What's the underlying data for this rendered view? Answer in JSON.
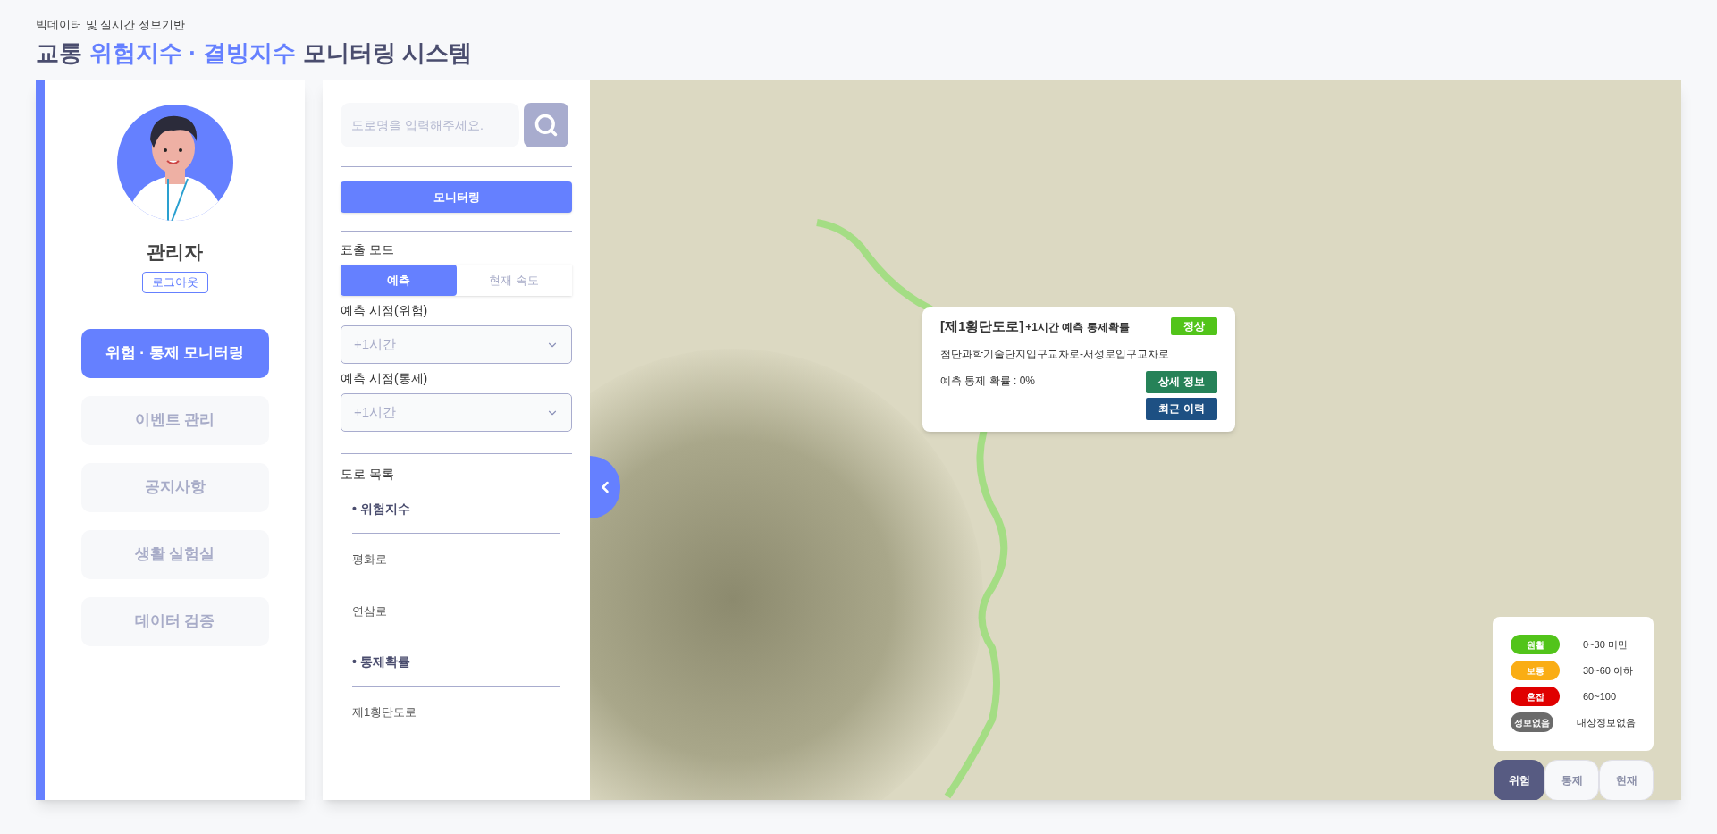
{
  "header": {
    "subtitle": "빅데이터 및 실시간 정보기반",
    "title_parts": [
      {
        "text": "교통",
        "highlight": false
      },
      {
        "text": "위험지수 · 결빙지수",
        "highlight": true
      },
      {
        "text": "모니터링 시스템",
        "highlight": false
      }
    ]
  },
  "profile": {
    "name": "관리자",
    "logout": "로그아웃"
  },
  "nav": [
    {
      "label": "위험 · 통제 모니터링",
      "selected": true
    },
    {
      "label": "이벤트 관리",
      "selected": false
    },
    {
      "label": "공지사항",
      "selected": false
    },
    {
      "label": "생활 실험실",
      "selected": false
    },
    {
      "label": "데이터 검증",
      "selected": false
    }
  ],
  "panel": {
    "search": {
      "placeholder": "도로명을 입력해주세요."
    },
    "monitor_button": "모니터링",
    "mode_label": "표출 모드",
    "modes": [
      {
        "label": "예측",
        "selected": true
      },
      {
        "label": "현재 속도",
        "selected": false
      }
    ],
    "selects": [
      {
        "label": "예측 시점(위험)",
        "value": "+1시간"
      },
      {
        "label": "예측 시점(통제)",
        "value": "+1시간"
      }
    ],
    "road_list_label": "도로 목록",
    "groups": [
      {
        "title": "• 위험지수",
        "roads": [
          "평화로",
          "연삼로"
        ]
      },
      {
        "title": "• 통제확률",
        "roads": [
          "제1횡단도로"
        ]
      }
    ]
  },
  "popup": {
    "road": "[제1횡단도로]",
    "subtitle": "+1시간 예측 통제확률",
    "status": {
      "label": "정상",
      "kind": "normal"
    },
    "segment": "첨단과학기술단지입구교차로-서성로입구교차로",
    "probability": "예측 통제 확률 : 0%",
    "buttons": [
      "상세 정보",
      "최근 이력"
    ]
  },
  "legend": [
    {
      "label": "원활",
      "range": "0~30 미만",
      "color": "#52c41a"
    },
    {
      "label": "보통",
      "range": "30~60 이하",
      "color": "#faad14"
    },
    {
      "label": "혼잡",
      "range": "60~100",
      "color": "#e00000"
    },
    {
      "label": "정보없음",
      "range": "대상정보없음",
      "color": "#6b6b6b"
    }
  ],
  "map_modes": [
    {
      "label": "위험",
      "selected": true
    },
    {
      "label": "통제",
      "selected": false
    },
    {
      "label": "현재",
      "selected": false
    }
  ]
}
